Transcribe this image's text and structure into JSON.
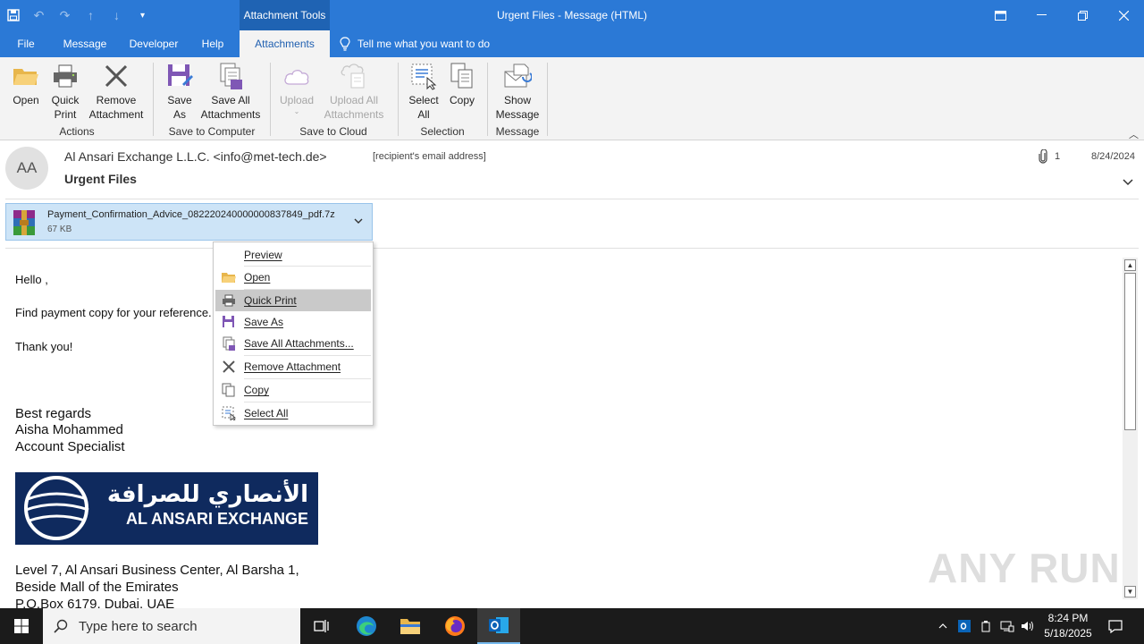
{
  "window": {
    "title": "Urgent Files  -  Message (HTML)",
    "context_tab_header": "Attachment Tools"
  },
  "ribbon_tabs": [
    "File",
    "Message",
    "Developer",
    "Help",
    "Attachments"
  ],
  "tell_me": "Tell me what you want to do",
  "ribbon": {
    "buttons": {
      "open": "Open",
      "quick_print_1": "Quick",
      "quick_print_2": "Print",
      "remove_1": "Remove",
      "remove_2": "Attachment",
      "save_as_1": "Save",
      "save_as_2": "As",
      "save_all_1": "Save All",
      "save_all_2": "Attachments",
      "upload": "Upload",
      "upload_all_1": "Upload All",
      "upload_all_2": "Attachments",
      "select_all_1": "Select",
      "select_all_2": "All",
      "copy": "Copy",
      "show_message_1": "Show",
      "show_message_2": "Message"
    },
    "groups": [
      "Actions",
      "Save to Computer",
      "Save to Cloud",
      "Selection",
      "Message"
    ]
  },
  "message": {
    "avatar_initials": "AA",
    "sender": "Al Ansari Exchange L.L.C.  <info@met-tech.de>",
    "recipient": "[recipient's email address]",
    "subject": "Urgent Files",
    "attachment_count": "1",
    "date": "8/24/2024"
  },
  "attachment": {
    "name": "Payment_Confirmation_Advice_082220240000000837849_pdf.7z",
    "size": "67 KB"
  },
  "body": {
    "greeting": "Hello ,",
    "line1": "Find payment copy for your reference.",
    "thanks": "Thank you!",
    "regards": "Best regards",
    "name": "Aisha Mohammed",
    "role": "Account Specialist",
    "logo_arabic": "الأنصاري للصرافة",
    "logo_english": "AL ANSARI EXCHANGE",
    "address1": "Level 7, Al Ansari Business Center, Al Barsha 1,",
    "address2": "Beside Mall of the Emirates",
    "address3": "P.O.Box 6179, Dubai, UAE"
  },
  "context_menu": {
    "items": [
      "Preview",
      "Open",
      "Quick Print",
      "Save As",
      "Save All Attachments...",
      "Remove Attachment",
      "Copy",
      "Select All"
    ],
    "highlighted": "Quick Print"
  },
  "watermark": "ANY RUN",
  "taskbar": {
    "search_placeholder": "Type here to search",
    "time": "8:24 PM",
    "date": "5/18/2025"
  },
  "colors": {
    "titlebar": "#2b79d6",
    "accent": "#1f5fb0",
    "menu_highlight": "#c9c9c9",
    "attachment_bg": "#cde4f7"
  }
}
